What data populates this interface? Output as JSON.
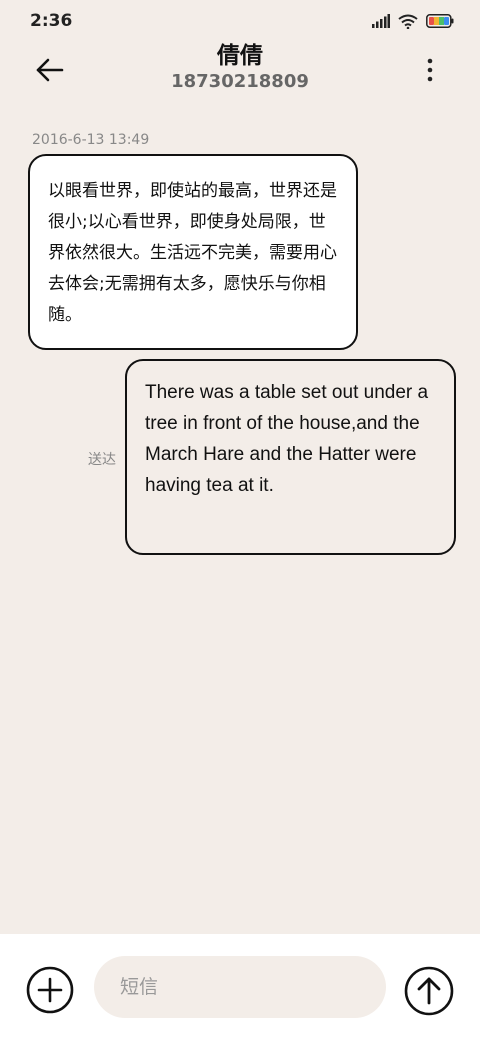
{
  "status": {
    "time": "2:36"
  },
  "header": {
    "title": "倩倩",
    "subtitle": "18730218809"
  },
  "messages": {
    "timestamp": "2016-6-13 13:49",
    "incoming": "以眼看世界，即使站的最高，世界还是很小;以心看世界，即使身处局限，世界依然很大。生活远不完美，需要用心去体会;无需拥有太多，愿快乐与你相随。",
    "outgoing": "There was a table set out under a tree in front of the house,and the March Hare and the Hatter were having tea at it.",
    "delivered_label": "送达"
  },
  "composer": {
    "placeholder": "短信"
  },
  "icons": {
    "back": "arrow-left-icon",
    "more": "more-vertical-icon",
    "add": "plus-circle-icon",
    "send": "arrow-up-circle-icon",
    "signal": "signal-icon",
    "wifi": "wifi-icon",
    "battery": "battery-icon"
  }
}
